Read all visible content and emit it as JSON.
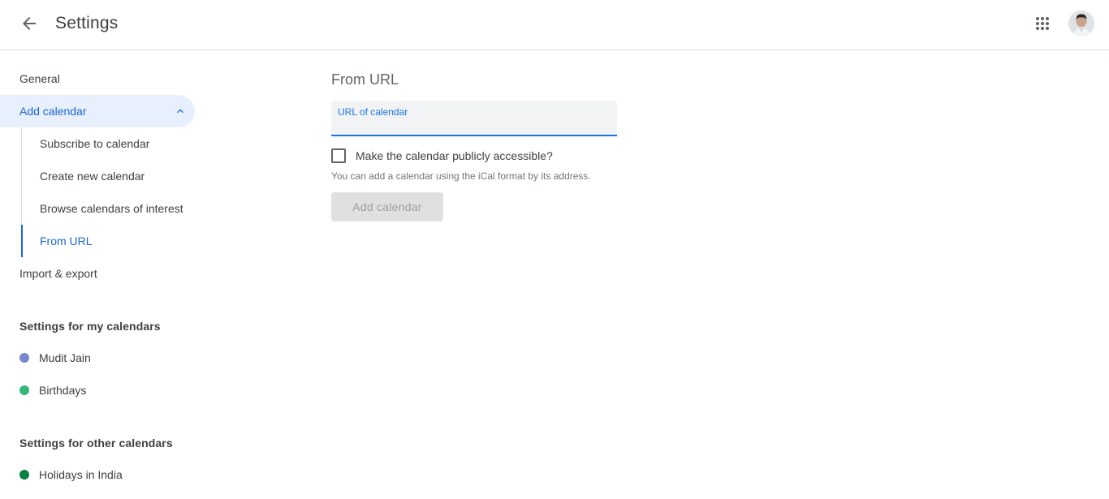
{
  "header": {
    "title": "Settings",
    "back_icon": "arrow-back-icon",
    "apps_icon": "apps-grid-icon"
  },
  "sidebar": {
    "general": "General",
    "add_calendar": {
      "label": "Add calendar",
      "expanded": true,
      "items": [
        {
          "label": "Subscribe to calendar"
        },
        {
          "label": "Create new calendar"
        },
        {
          "label": "Browse calendars of interest"
        },
        {
          "label": "From URL",
          "selected": true
        }
      ]
    },
    "import_export": "Import & export",
    "my_calendars": {
      "heading": "Settings for my calendars",
      "items": [
        {
          "label": "Mudit Jain",
          "color": "#7986cb"
        },
        {
          "label": "Birthdays",
          "color": "#33b679"
        }
      ]
    },
    "other_calendars": {
      "heading": "Settings for other calendars",
      "items": [
        {
          "label": "Holidays in India",
          "color": "#0b8043"
        }
      ]
    }
  },
  "main": {
    "section_title": "From URL",
    "url_field": {
      "label": "URL of calendar",
      "value": ""
    },
    "public_checkbox": {
      "label": "Make the calendar publicly accessible?",
      "checked": false
    },
    "helper_text": "You can add a calendar using the iCal format by its address.",
    "add_button": "Add calendar"
  },
  "colors": {
    "accent": "#1a73e8",
    "active_text": "#1967d2",
    "active_bg": "#e8f0fe"
  }
}
